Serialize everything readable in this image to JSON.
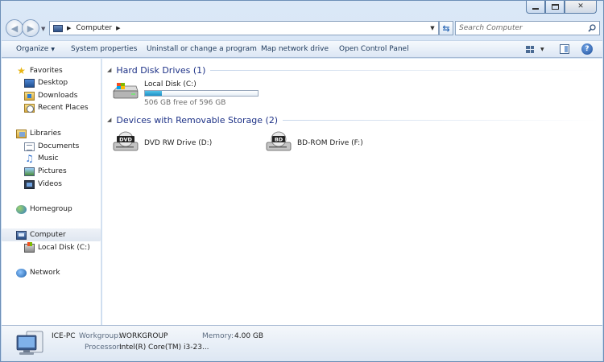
{
  "window": {
    "title_buttons": {
      "minimize": "",
      "maximize": "",
      "close": "✕"
    }
  },
  "address": {
    "path": "Computer",
    "search_placeholder": "Search Computer"
  },
  "toolbar": {
    "organize": "Organize",
    "system_properties": "System properties",
    "uninstall": "Uninstall or change a program",
    "map_network": "Map network drive",
    "control_panel": "Open Control Panel",
    "help": "?"
  },
  "nav": {
    "favorites": "Favorites",
    "desktop": "Desktop",
    "downloads": "Downloads",
    "recent": "Recent Places",
    "libraries": "Libraries",
    "documents": "Documents",
    "music": "Music",
    "pictures": "Pictures",
    "videos": "Videos",
    "homegroup": "Homegroup",
    "computer": "Computer",
    "local_disk": "Local Disk (C:)",
    "network": "Network"
  },
  "groups": {
    "hdd_title": "Hard Disk Drives (1)",
    "removable_title": "Devices with Removable Storage (2)"
  },
  "drives": {
    "c_name": "Local Disk (C:)",
    "c_free": "506 GB free of 596 GB",
    "c_used_fraction": 0.15,
    "d_name": "DVD RW Drive (D:)",
    "d_label": "DVD",
    "f_name": "BD-ROM Drive (F:)",
    "f_label": "BD"
  },
  "details": {
    "computer_name": "ICE-PC",
    "workgroup_label": "Workgroup:",
    "workgroup_value": "WORKGROUP",
    "memory_label": "Memory:",
    "memory_value": "4.00 GB",
    "processor_label": "Processor:",
    "processor_value": "Intel(R) Core(TM) i3-23..."
  }
}
